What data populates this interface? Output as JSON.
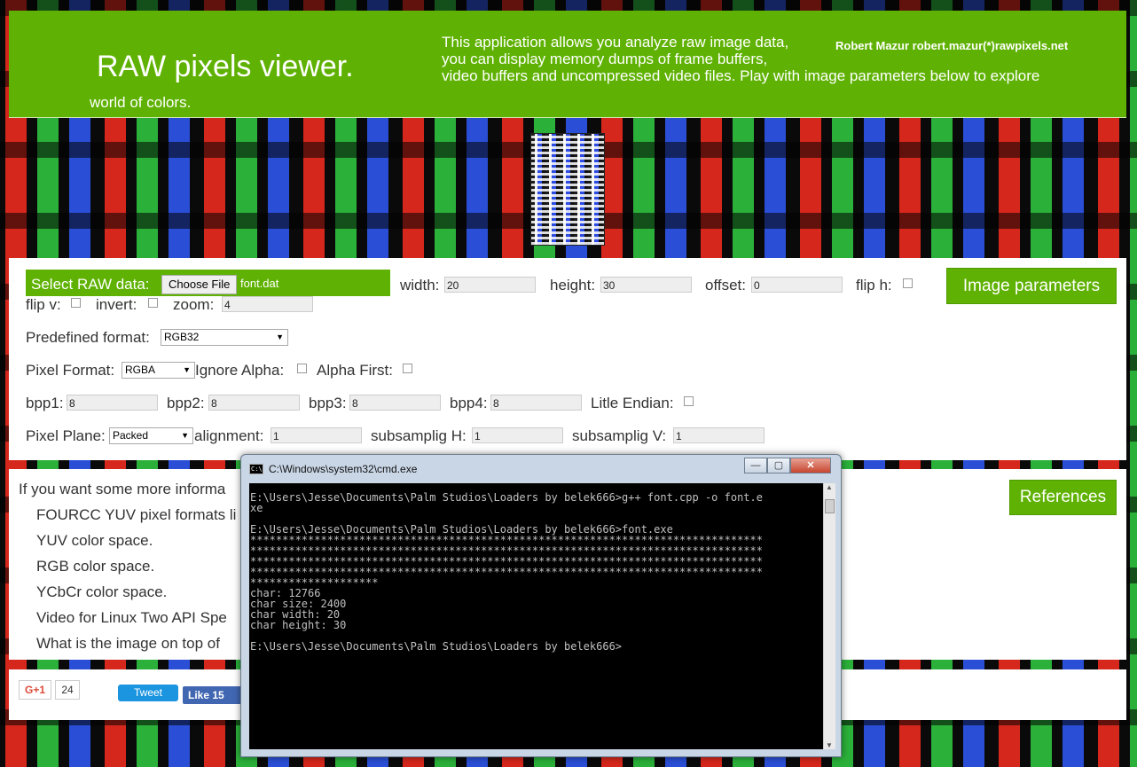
{
  "header": {
    "title": "RAW pixels viewer.",
    "subtitle": "world of colors.",
    "desc_line1": "This application allows you analyze raw image data,",
    "desc_line2": "you can display memory dumps of frame buffers,",
    "desc_line3": "video buffers and uncompressed video files. Play with image parameters below to explore",
    "author": "Robert Mazur robert.mazur(*)rawpixels.net"
  },
  "params": {
    "select_label": "Select RAW data:",
    "choose_file": "Choose File",
    "file_name": "font.dat",
    "width_label": "width:",
    "width_value": "20",
    "height_label": "height:",
    "height_value": "30",
    "offset_label": "offset:",
    "offset_value": "0",
    "flip_h_label": "flip h:",
    "flip_v_label": "flip v:",
    "invert_label": "invert:",
    "zoom_label": "zoom:",
    "zoom_value": "4",
    "image_params_button": "Image parameters",
    "predefined_label": "Predefined format:",
    "predefined_value": "RGB32",
    "pixel_format_label": "Pixel Format:",
    "pixel_format_value": "RGBA",
    "ignore_alpha_label": "Ignore Alpha:",
    "alpha_first_label": "Alpha First:",
    "bpp1_label": "bpp1:",
    "bpp1_value": "8",
    "bpp2_label": "bpp2:",
    "bpp2_value": "8",
    "bpp3_label": "bpp3:",
    "bpp3_value": "8",
    "bpp4_label": "bpp4:",
    "bpp4_value": "8",
    "little_endian_label": "Litle Endian:",
    "pixel_plane_label": "Pixel Plane:",
    "pixel_plane_value": "Packed",
    "alignment_label": "alignment:",
    "alignment_value": "1",
    "subsampling_h_label": "subsamplig H:",
    "subsampling_h_value": "1",
    "subsampling_v_label": "subsamplig V:",
    "subsampling_v_value": "1"
  },
  "references": {
    "intro": "If you want some more informa",
    "button": "References",
    "items": [
      "FOURCC YUV pixel formats li",
      "YUV color space.",
      "RGB color space.",
      "YCbCr color space.",
      "Video for Linux Two API Spe",
      "What is the image on top of"
    ]
  },
  "social": {
    "gplus": "G+1",
    "gplus_count": "24",
    "tweet": "Tweet",
    "like": "Like 15"
  },
  "cmd": {
    "title": "C:\\Windows\\system32\\cmd.exe",
    "icon_text": "C:\\",
    "minimize": "—",
    "maximize": "▢",
    "close": "✕",
    "console": "E:\\Users\\Jesse\\Documents\\Palm Studios\\Loaders by belek666>g++ font.cpp -o font.e\nxe\n\nE:\\Users\\Jesse\\Documents\\Palm Studios\\Loaders by belek666>font.exe\n********************************************************************************\n********************************************************************************\n********************************************************************************\n********************************************************************************\n********************\nchar: 12766\nchar size: 2400\nchar width: 20\nchar height: 30\n\nE:\\Users\\Jesse\\Documents\\Palm Studios\\Loaders by belek666>"
  },
  "icons": {
    "dropdown": "▼",
    "scroll_up": "▲",
    "scroll_down": "▼"
  },
  "colors": {
    "accent_green": "#5fb203",
    "twitter_blue": "#1b95e0",
    "facebook_blue": "#4267b2"
  }
}
